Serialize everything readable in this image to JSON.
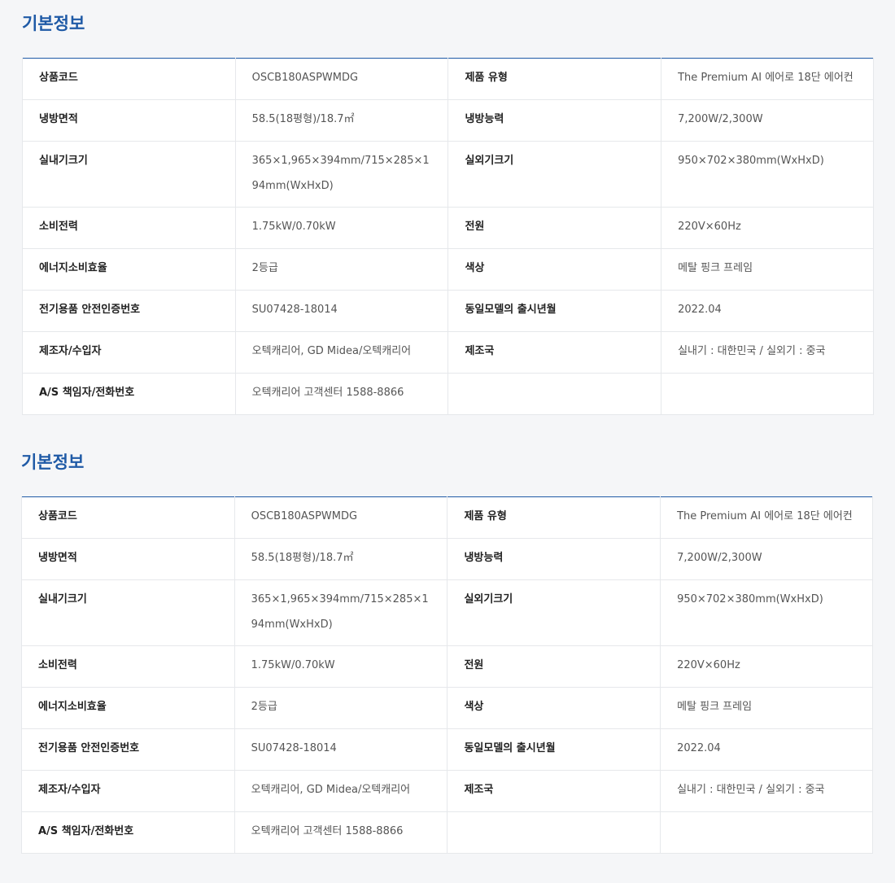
{
  "sections": [
    {
      "title": "기본정보",
      "rows": [
        {
          "k1": "상품코드",
          "v1": "OSCB180ASPWMDG",
          "k2": "제품 유형",
          "v2": "The Premium AI 에어로 18단 에어컨"
        },
        {
          "k1": "냉방면적",
          "v1": "58.5(18평형)/18.7㎡",
          "k2": "냉방능력",
          "v2": "7,200W/2,300W"
        },
        {
          "k1": "실내기크기",
          "v1": "365×1,965×394mm/715×285×194mm(WxHxD)",
          "k2": "실외기크기",
          "v2": "950×702×380mm(WxHxD)"
        },
        {
          "k1": "소비전력",
          "v1": "1.75kW/0.70kW",
          "k2": "전원",
          "v2": "220V×60Hz"
        },
        {
          "k1": "에너지소비효율",
          "v1": "2등급",
          "k2": "색상",
          "v2": "메탈 핑크 프레임"
        },
        {
          "k1": "전기용품 안전인증번호",
          "v1": "SU07428-18014",
          "k2": "동일모델의 출시년월",
          "v2": "2022.04"
        },
        {
          "k1": "제조자/수입자",
          "v1": "오텍캐리어, GD Midea/오텍캐리어",
          "k2": "제조국",
          "v2": "실내기 : 대한민국 / 실외기 : 중국"
        },
        {
          "k1": "A/S 책임자/전화번호",
          "v1": "오텍캐리어 고객센터 1588-8866",
          "k2": "",
          "v2": ""
        }
      ]
    },
    {
      "title": "기본정보",
      "rows": [
        {
          "k1": "상품코드",
          "v1": "OSCB180ASPWMDG",
          "k2": "제품 유형",
          "v2": "The Premium AI 에어로 18단 에어컨"
        },
        {
          "k1": "냉방면적",
          "v1": "58.5(18평형)/18.7㎡",
          "k2": "냉방능력",
          "v2": "7,200W/2,300W"
        },
        {
          "k1": "실내기크기",
          "v1": "365×1,965×394mm/715×285×194mm(WxHxD)",
          "k2": "실외기크기",
          "v2": "950×702×380mm(WxHxD)"
        },
        {
          "k1": "소비전력",
          "v1": "1.75kW/0.70kW",
          "k2": "전원",
          "v2": "220V×60Hz"
        },
        {
          "k1": "에너지소비효율",
          "v1": "2등급",
          "k2": "색상",
          "v2": "메탈 핑크 프레임"
        },
        {
          "k1": "전기용품 안전인증번호",
          "v1": "SU07428-18014",
          "k2": "동일모델의 출시년월",
          "v2": "2022.04"
        },
        {
          "k1": "제조자/수입자",
          "v1": "오텍캐리어, GD Midea/오텍캐리어",
          "k2": "제조국",
          "v2": "실내기 : 대한민국 / 실외기 : 중국"
        },
        {
          "k1": "A/S 책임자/전화번호",
          "v1": "오텍캐리어 고객센터 1588-8866",
          "k2": "",
          "v2": ""
        }
      ]
    }
  ]
}
